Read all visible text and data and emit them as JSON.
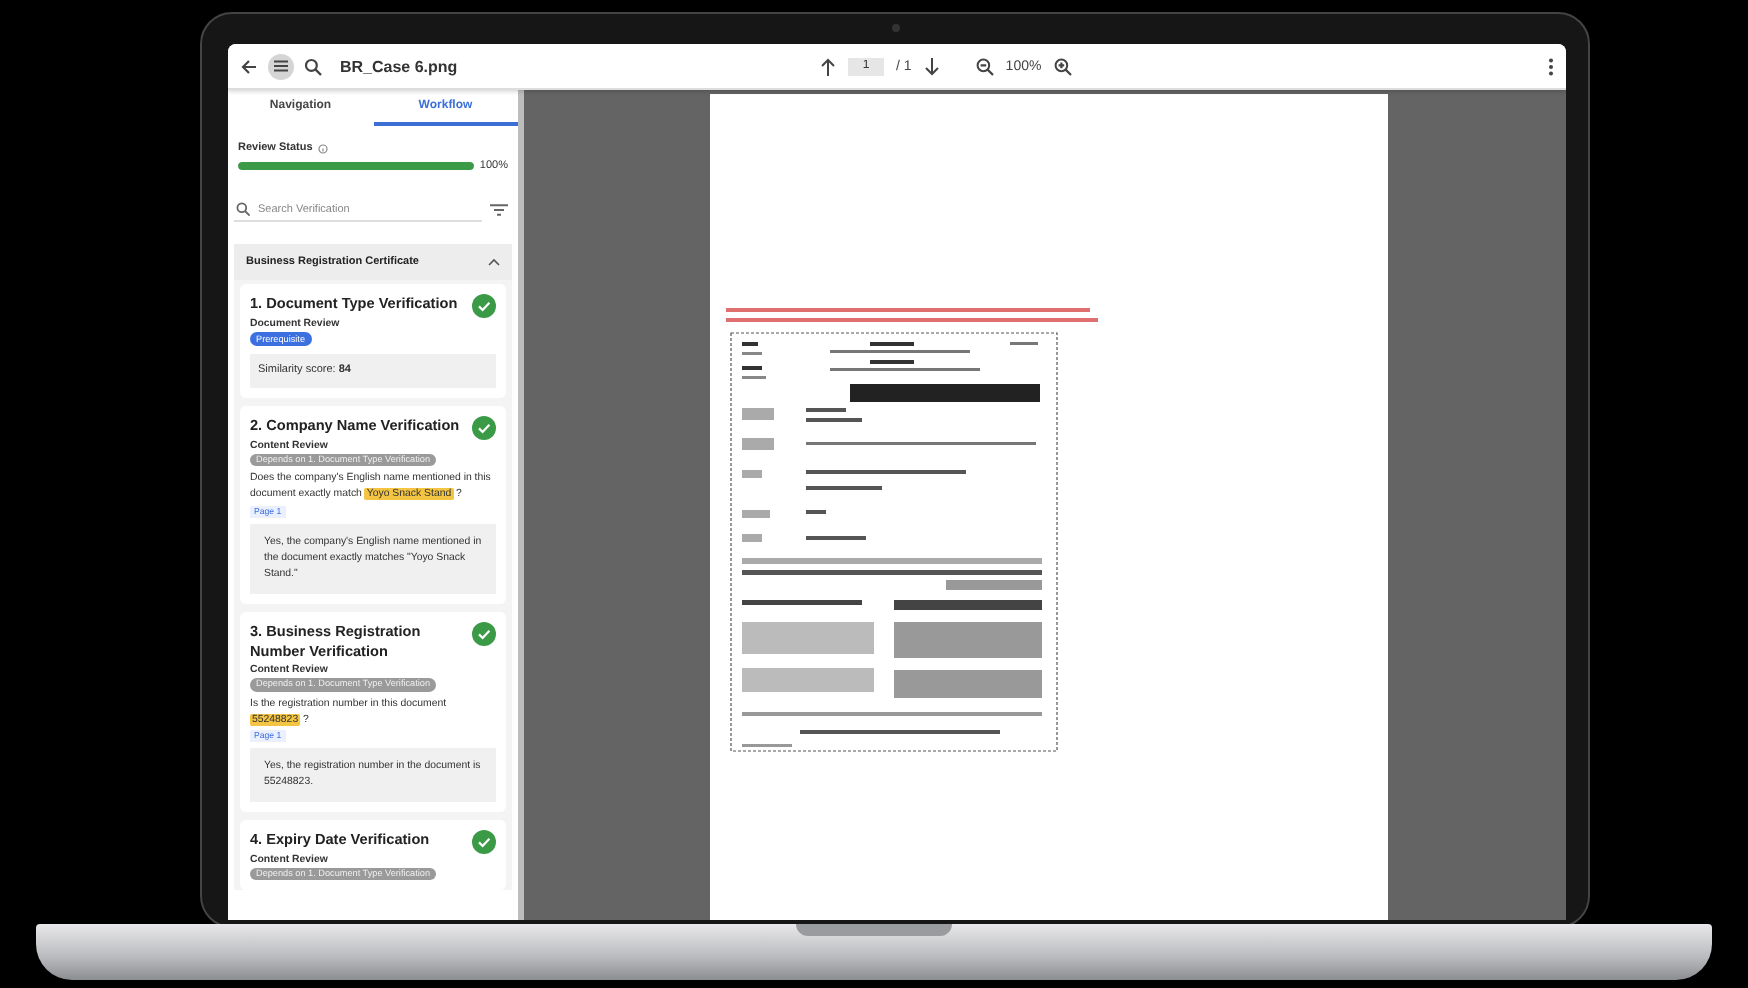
{
  "toolbar": {
    "file_name": "BR_Case 6.png",
    "page_input": "1",
    "page_total": "/ 1",
    "zoom": "100%"
  },
  "sidebar": {
    "tabs": [
      {
        "label": "Navigation",
        "selected": false
      },
      {
        "label": "Workflow",
        "selected": true
      }
    ],
    "review_status": {
      "label": "Review Status",
      "level": 1,
      "reading": "100%"
    },
    "search": {
      "placeholder": "Search Verification"
    },
    "section": {
      "title": "Business Registration Certificate",
      "expanded": true
    },
    "checks": [
      {
        "title": "1. Document Type Verification",
        "done": true,
        "review": "Document Review",
        "badge": {
          "kind": "prerequisite",
          "text": "Prerequisite"
        },
        "result": "Similarity score: **84**"
      },
      {
        "title": "2. Company Name Verification",
        "done": true,
        "review": "Content Review",
        "badge": {
          "kind": "dependency",
          "text": "Depends on 1. Document Type Verification"
        },
        "question": {
          "text": "Does the company's English name mentioned in this document exactly match ",
          "highlight": "Yoyo Snack Stand",
          "after": " ?"
        },
        "page_link": "Page 1",
        "result": "Yes, the company's English name mentioned in the document exactly matches \"Yoyo Snack Stand.\""
      },
      {
        "title": "3. Business Registration Number Verification",
        "done": true,
        "review": "Content Review",
        "badge": {
          "kind": "dependency",
          "text": "Depends on 1. Document Type Verification"
        },
        "question": {
          "text": "Is the registration number in this document ",
          "highlight": "55248823",
          "after": " ?"
        },
        "page_link": "Page 1",
        "result": "Yes, the registration number in the document is 55248823."
      },
      {
        "title": "4. Expiry Date Verification",
        "done": true,
        "review": "Content Review",
        "badge": {
          "kind": "dependency",
          "text": "Depends on 1. Document Type Verification"
        }
      }
    ]
  }
}
